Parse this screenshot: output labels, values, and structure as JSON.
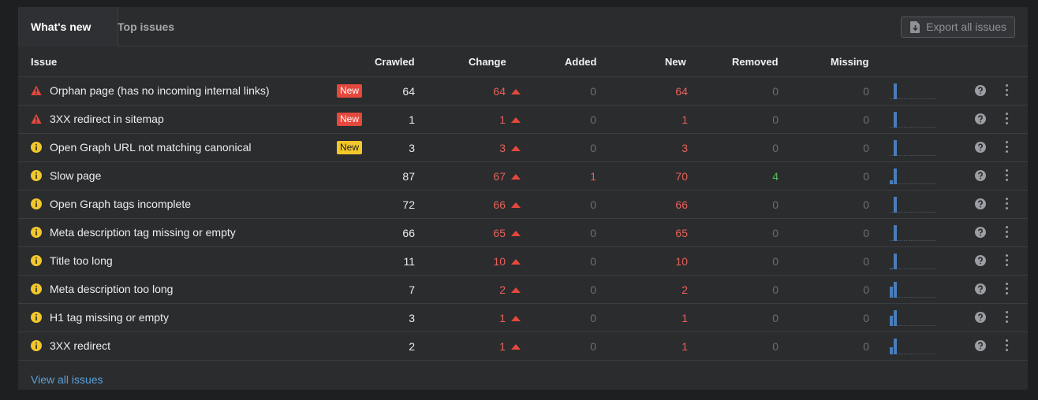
{
  "tabs": [
    {
      "label": "What's new"
    },
    {
      "label": "Top issues"
    }
  ],
  "export_button": {
    "label": "Export all issues",
    "icon": "export-file-icon"
  },
  "columns": {
    "issue": "Issue",
    "crawled": "Crawled",
    "change": "Change",
    "added": "Added",
    "new": "New",
    "removed": "Removed",
    "missing": "Missing"
  },
  "colors": {
    "error": "#e5483c",
    "warning": "#f2c72a",
    "increase": "#e8615a",
    "positive": "#52c05b",
    "link": "#5aa0d8",
    "sparkline": "#4a7db8"
  },
  "rows": [
    {
      "severity": "error",
      "icon": "warning-triangle-icon",
      "issue": "Orphan page (has no incoming internal links)",
      "badge": "New",
      "badge_color": "red",
      "crawled": "64",
      "change": "64",
      "added": "0",
      "new": "64",
      "removed": "0",
      "missing": "0",
      "history": [
        0,
        0,
        0,
        0,
        0,
        0,
        0,
        0,
        0,
        0,
        0,
        0,
        0
      ]
    },
    {
      "severity": "error",
      "icon": "warning-triangle-icon",
      "issue": "3XX redirect in sitemap",
      "badge": "New",
      "badge_color": "red",
      "crawled": "1",
      "change": "1",
      "added": "0",
      "new": "1",
      "removed": "0",
      "missing": "0",
      "history": [
        0,
        0,
        0,
        0,
        0,
        0,
        0,
        0,
        0,
        0,
        0,
        0,
        0
      ]
    },
    {
      "severity": "warning",
      "icon": "info-circle-icon",
      "issue": "Open Graph URL not matching canonical",
      "badge": "New",
      "badge_color": "yellow",
      "crawled": "3",
      "change": "3",
      "added": "0",
      "new": "3",
      "removed": "0",
      "missing": "0",
      "history": [
        0,
        0,
        0,
        0,
        0,
        0,
        0,
        0,
        0,
        0,
        0,
        0,
        0
      ]
    },
    {
      "severity": "warning",
      "icon": "info-circle-icon",
      "issue": "Slow page",
      "badge": "",
      "badge_color": "",
      "crawled": "87",
      "change": "67",
      "added": "1",
      "new": "70",
      "removed": "4",
      "missing": "0",
      "history": [
        0.25,
        0,
        0,
        0,
        0,
        0,
        0,
        0,
        0,
        0,
        0,
        0,
        0
      ]
    },
    {
      "severity": "warning",
      "icon": "info-circle-icon",
      "issue": "Open Graph tags incomplete",
      "badge": "",
      "badge_color": "",
      "crawled": "72",
      "change": "66",
      "added": "0",
      "new": "66",
      "removed": "0",
      "missing": "0",
      "history": [
        0,
        0,
        0,
        0,
        0,
        0,
        0,
        0,
        0,
        0,
        0,
        0,
        0
      ]
    },
    {
      "severity": "warning",
      "icon": "info-circle-icon",
      "issue": "Meta description tag missing or empty",
      "badge": "",
      "badge_color": "",
      "crawled": "66",
      "change": "65",
      "added": "0",
      "new": "65",
      "removed": "0",
      "missing": "0",
      "history": [
        0,
        0,
        0,
        0,
        0,
        0,
        0,
        0,
        0,
        0,
        0,
        0,
        0
      ]
    },
    {
      "severity": "warning",
      "icon": "info-circle-icon",
      "issue": "Title too long",
      "badge": "",
      "badge_color": "",
      "crawled": "11",
      "change": "10",
      "added": "0",
      "new": "10",
      "removed": "0",
      "missing": "0",
      "history": [
        0.05,
        0,
        0,
        0,
        0,
        0,
        0,
        0,
        0,
        0,
        0,
        0,
        0
      ]
    },
    {
      "severity": "warning",
      "icon": "info-circle-icon",
      "issue": "Meta description too long",
      "badge": "",
      "badge_color": "",
      "crawled": "7",
      "change": "2",
      "added": "0",
      "new": "2",
      "removed": "0",
      "missing": "0",
      "history": [
        0.7,
        0,
        0,
        0,
        0,
        0,
        0,
        0,
        0,
        0,
        0,
        0,
        0
      ]
    },
    {
      "severity": "warning",
      "icon": "info-circle-icon",
      "issue": "H1 tag missing or empty",
      "badge": "",
      "badge_color": "",
      "crawled": "3",
      "change": "1",
      "added": "0",
      "new": "1",
      "removed": "0",
      "missing": "0",
      "history": [
        0.65,
        0,
        0,
        0,
        0,
        0,
        0,
        0,
        0,
        0,
        0,
        0,
        0
      ]
    },
    {
      "severity": "warning",
      "icon": "info-circle-icon",
      "issue": "3XX redirect",
      "badge": "",
      "badge_color": "",
      "crawled": "2",
      "change": "1",
      "added": "0",
      "new": "1",
      "removed": "0",
      "missing": "0",
      "history": [
        0.45,
        0,
        0,
        0,
        0,
        0,
        0,
        0,
        0,
        0,
        0,
        0,
        0
      ]
    }
  ],
  "row_actions": {
    "help_icon": "question-circle-icon",
    "more_icon": "kebab-menu-icon"
  },
  "footer": {
    "link_label": "View all issues"
  }
}
